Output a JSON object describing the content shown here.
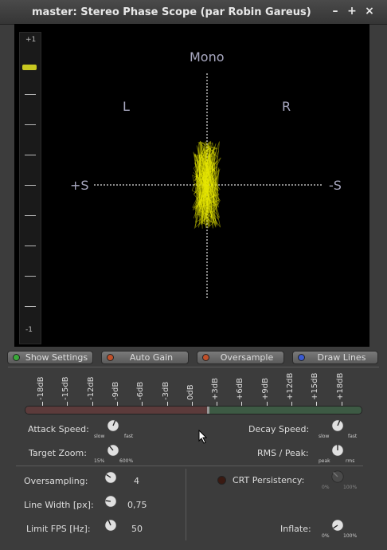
{
  "window": {
    "title": "master: Stereo Phase Scope (par Robin Gareus)",
    "minimize": "–",
    "maximize": "+",
    "close": "×"
  },
  "scope": {
    "mono_label": "Mono",
    "left_label": "L",
    "right_label": "R",
    "plus_s_label": "+S",
    "minus_s_label": "-S",
    "meter_top_label": "+1",
    "meter_bottom_label": "-1",
    "meter_value": 0.88,
    "trace_color": "#e6e600"
  },
  "toggles": [
    {
      "label": "Show Settings",
      "led": "#3aa83a"
    },
    {
      "label": "Auto Gain",
      "led": "#c0502a"
    },
    {
      "label": "Oversample",
      "led": "#c0502a"
    },
    {
      "label": "Draw Lines",
      "led": "#3a5ad0"
    }
  ],
  "db_scale": [
    "-18dB",
    "-15dB",
    "-12dB",
    "-9dB",
    "-6dB",
    "-3dB",
    "0dB",
    "+3dB",
    "+6dB",
    "+9dB",
    "+12dB",
    "+15dB",
    "+18dB"
  ],
  "settings": {
    "attack_speed": {
      "label": "Attack Speed:",
      "min": "slow",
      "max": "fast"
    },
    "decay_speed": {
      "label": "Decay Speed:",
      "min": "slow",
      "max": "fast"
    },
    "target_zoom": {
      "label": "Target Zoom:",
      "min": "15%",
      "max": "600%"
    },
    "rms_peak": {
      "label": "RMS / Peak:",
      "min": "peak",
      "max": "rms"
    },
    "oversampling": {
      "label": "Oversampling:",
      "value": "4"
    },
    "line_width": {
      "label": "Line Width [px]:",
      "value": "0,75"
    },
    "limit_fps": {
      "label": "Limit FPS [Hz]:",
      "value": "50"
    },
    "crt_persistency": {
      "label": "CRT Persistency:",
      "min": "0%",
      "max": "100%"
    },
    "inflate": {
      "label": "Inflate:",
      "min": "0%",
      "max": "100%"
    }
  },
  "colors": {
    "accent_yellow": "#e6e600",
    "led_green": "#3aa83a",
    "led_red": "#c0502a",
    "led_blue": "#3a5ad0"
  }
}
